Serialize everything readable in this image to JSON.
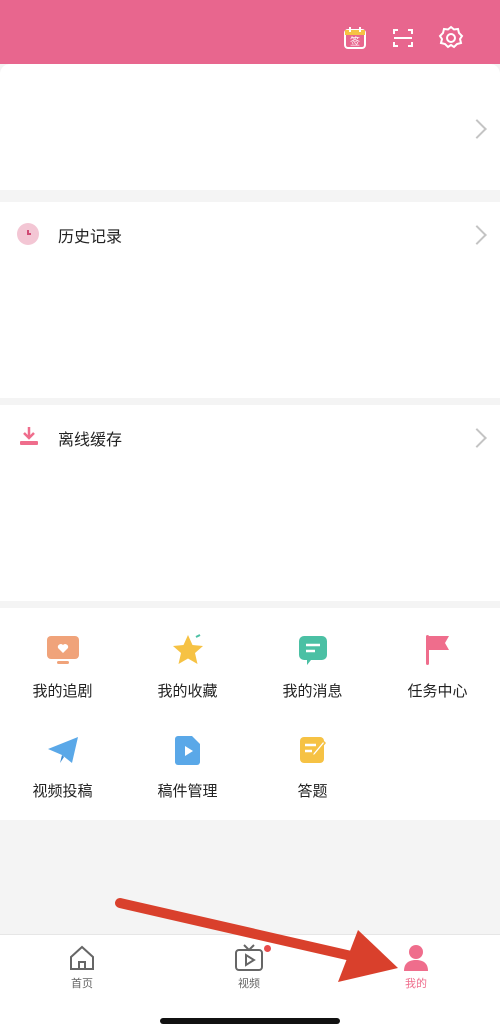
{
  "header": {
    "icons": [
      "calendar-sign-icon",
      "scan-icon",
      "settings-icon"
    ],
    "sign_char": "签"
  },
  "history": {
    "label": "历史记录"
  },
  "offline": {
    "label": "离线缓存"
  },
  "grid": [
    {
      "label": "我的追剧",
      "icon": "tv-heart-icon",
      "color": "#f0a37a"
    },
    {
      "label": "我的收藏",
      "icon": "star-icon",
      "color": "#f6c244"
    },
    {
      "label": "我的消息",
      "icon": "message-icon",
      "color": "#4bc0a4"
    },
    {
      "label": "任务中心",
      "icon": "flag-icon",
      "color": "#ef6d8c"
    },
    {
      "label": "视频投稿",
      "icon": "paper-plane-icon",
      "color": "#5aa8e8"
    },
    {
      "label": "稿件管理",
      "icon": "video-file-icon",
      "color": "#5aa8e8"
    },
    {
      "label": "答题",
      "icon": "edit-note-icon",
      "color": "#f6c244"
    }
  ],
  "tabs": {
    "home": "首页",
    "video": "视频",
    "mine": "我的"
  },
  "colors": {
    "brand": "#e8668e",
    "annotation_arrow": "#d9402c"
  }
}
